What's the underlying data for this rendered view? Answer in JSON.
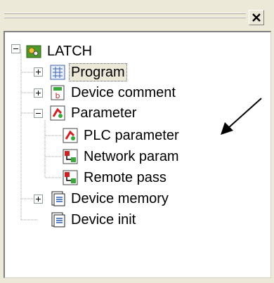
{
  "panel": {
    "close_label": "×"
  },
  "tree": {
    "root": {
      "label": "LATCH",
      "icon": "project-icon",
      "expanded": true
    },
    "items": [
      {
        "label": "Program",
        "icon": "program-icon",
        "expander": "plus",
        "selected": true
      },
      {
        "label": "Device comment",
        "icon": "device-comment-icon",
        "expander": "plus"
      },
      {
        "label": "Parameter",
        "icon": "parameter-icon",
        "expander": "minus"
      },
      {
        "label": "PLC parameter",
        "icon": "plc-parameter-icon"
      },
      {
        "label": "Network param",
        "icon": "network-param-icon"
      },
      {
        "label": "Remote pass",
        "icon": "remote-pass-icon"
      },
      {
        "label": "Device memory",
        "icon": "device-memory-icon",
        "expander": "plus"
      },
      {
        "label": "Device init",
        "icon": "device-init-icon"
      }
    ]
  },
  "colors": {
    "panel_bg": "#ece9d8",
    "tree_bg": "#ffffff",
    "arrow": "#000000"
  }
}
